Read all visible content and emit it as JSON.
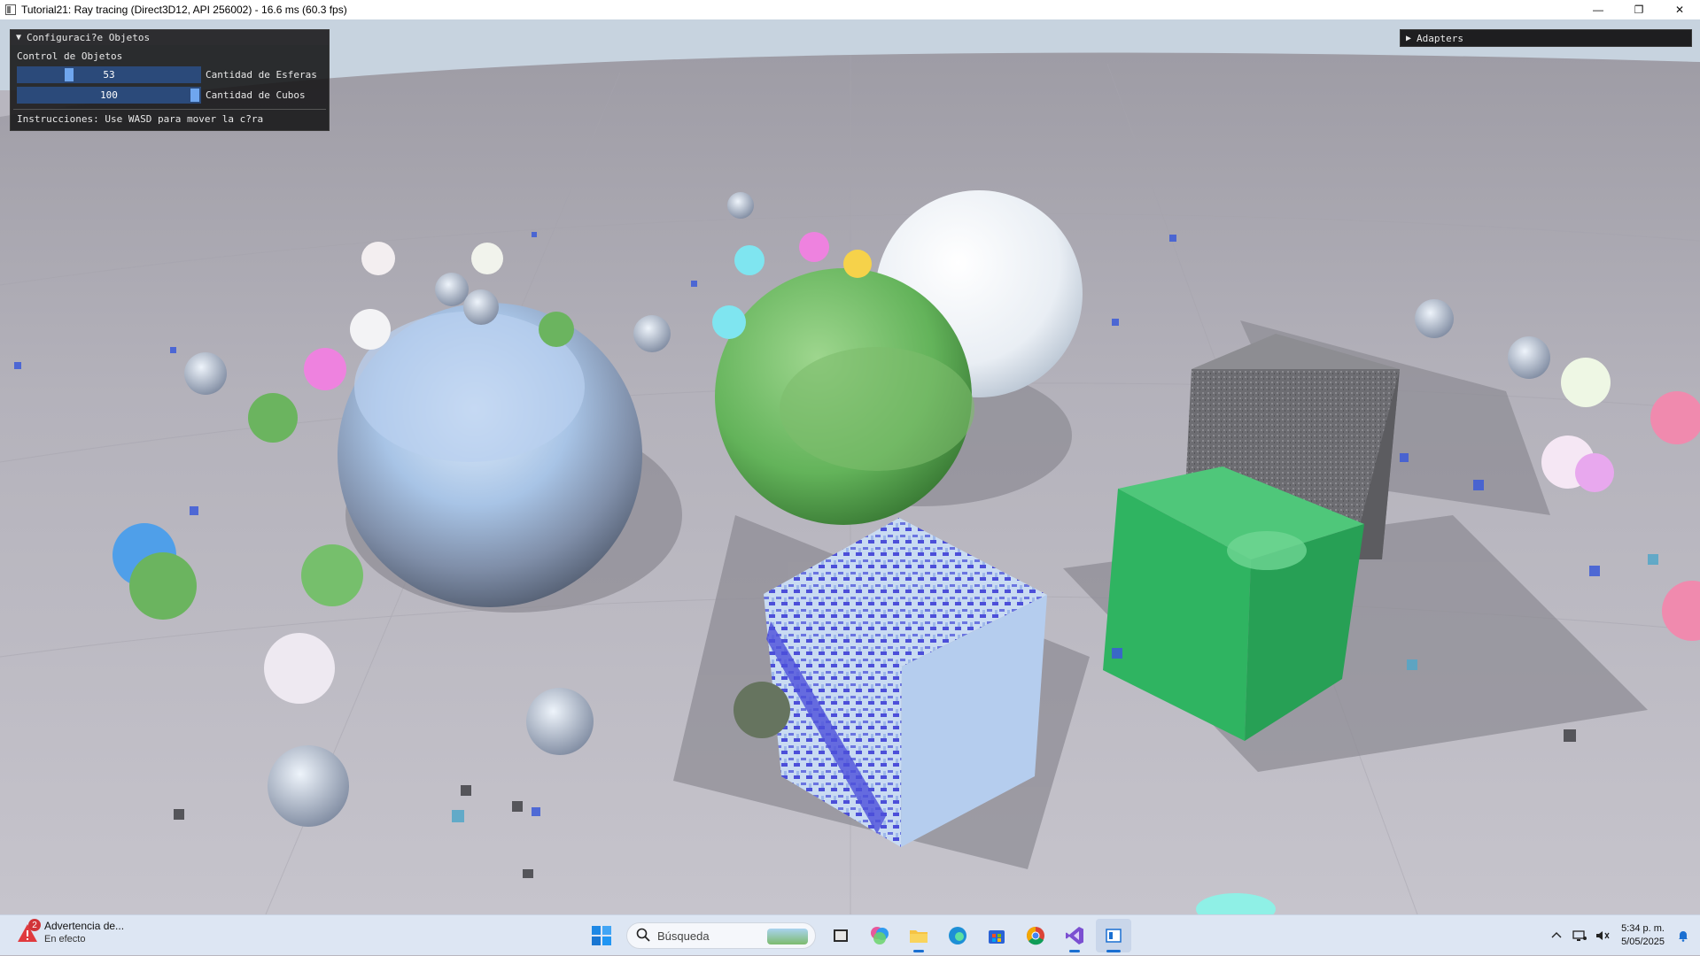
{
  "window": {
    "title": "Tutorial21: Ray tracing (Direct3D12, API 256002) - 16.6 ms (60.3 fps)",
    "controls": {
      "minimize": "—",
      "restore": "❐",
      "close": "✕"
    }
  },
  "config_panel": {
    "title": "Configuraci?e Objetos",
    "section": "Control de Objetos",
    "sliders": [
      {
        "value": "53",
        "label": "Cantidad de Esferas",
        "fraction": 0.27
      },
      {
        "value": "100",
        "label": "Cantidad de Cubos",
        "fraction": 1.0
      }
    ],
    "instructions": "Instrucciones: Use WASD para mover la c?ra"
  },
  "adapters_panel": {
    "title": "Adapters"
  },
  "taskbar": {
    "notification": {
      "badge": "2",
      "title": "Advertencia de...",
      "subtitle": "En efecto"
    },
    "search_placeholder": "Búsqueda",
    "apps": [
      "start-icon",
      "file-manager-icon",
      "m365-icon",
      "file-explorer-icon",
      "edge-icon",
      "store-icon",
      "chrome-icon",
      "visual-studio-icon",
      "tutorial-app-icon"
    ],
    "time": "5:34 p. m.",
    "date": "5/05/2025"
  },
  "colors": {
    "accent": "#6fa6ee",
    "slider_bg": "#2b4a7a",
    "panel_bg": "#141416",
    "taskbar_bg": "#dde6f3"
  }
}
